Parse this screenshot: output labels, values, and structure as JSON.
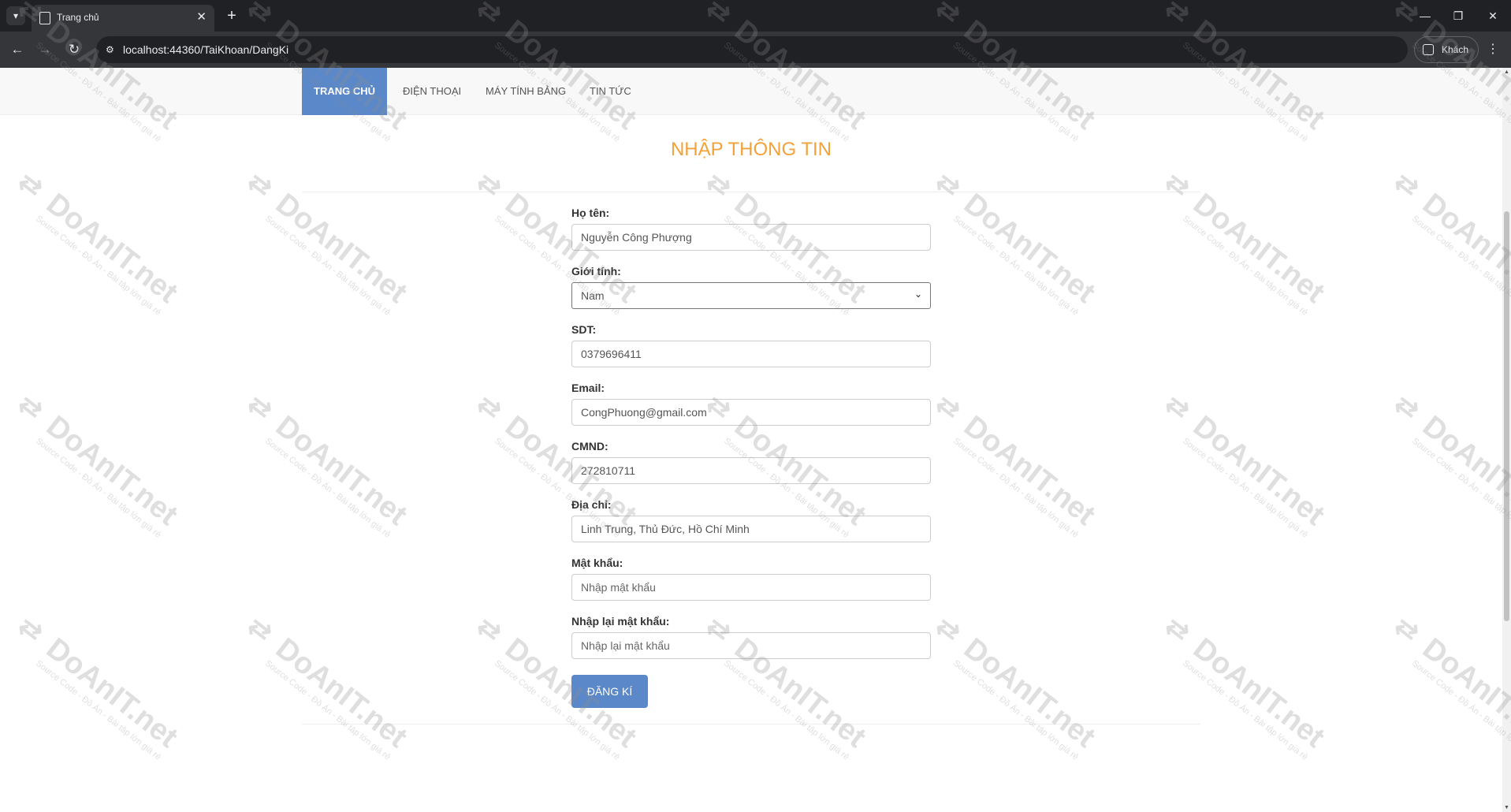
{
  "browser": {
    "tab_title": "Trang chủ",
    "url": "localhost:44360/TaiKhoan/DangKi",
    "profile_label": "Khách"
  },
  "navbar": {
    "items": [
      {
        "label": "Trang chủ",
        "active": true
      },
      {
        "label": "Điện thoại",
        "active": false
      },
      {
        "label": "Máy tính bảng",
        "active": false
      },
      {
        "label": "Tin tức",
        "active": false
      }
    ]
  },
  "form": {
    "heading": "NHẬP THÔNG TIN",
    "fields": {
      "name": {
        "label": "Họ tên:",
        "value": "Nguyễn Công Phượng"
      },
      "gender": {
        "label": "Giới tính:",
        "value": "Nam"
      },
      "phone": {
        "label": "SDT:",
        "value": "0379696411"
      },
      "email": {
        "label": "Email:",
        "value": "CongPhuong@gmail.com"
      },
      "id_card": {
        "label": "CMND:",
        "value": "272810711"
      },
      "address": {
        "label": "Địa chỉ:",
        "value": "Linh Trung, Thủ Đức, Hồ Chí Minh"
      },
      "password": {
        "label": "Mật khẩu:",
        "placeholder": "Nhập mật khẩu"
      },
      "password_confirm": {
        "label": "Nhập lại mật khẩu:",
        "placeholder": "Nhập lại mật khẩu"
      }
    },
    "submit_label": "Đăng kí"
  },
  "watermark": {
    "name": "DoAnIT.net",
    "tagline": "Source Code - Đồ Án - Bài tập lớn giá rẻ"
  },
  "colors": {
    "accent_blue": "#5b88c9",
    "heading_orange": "#f2a23a",
    "chrome_dark": "#202124"
  }
}
